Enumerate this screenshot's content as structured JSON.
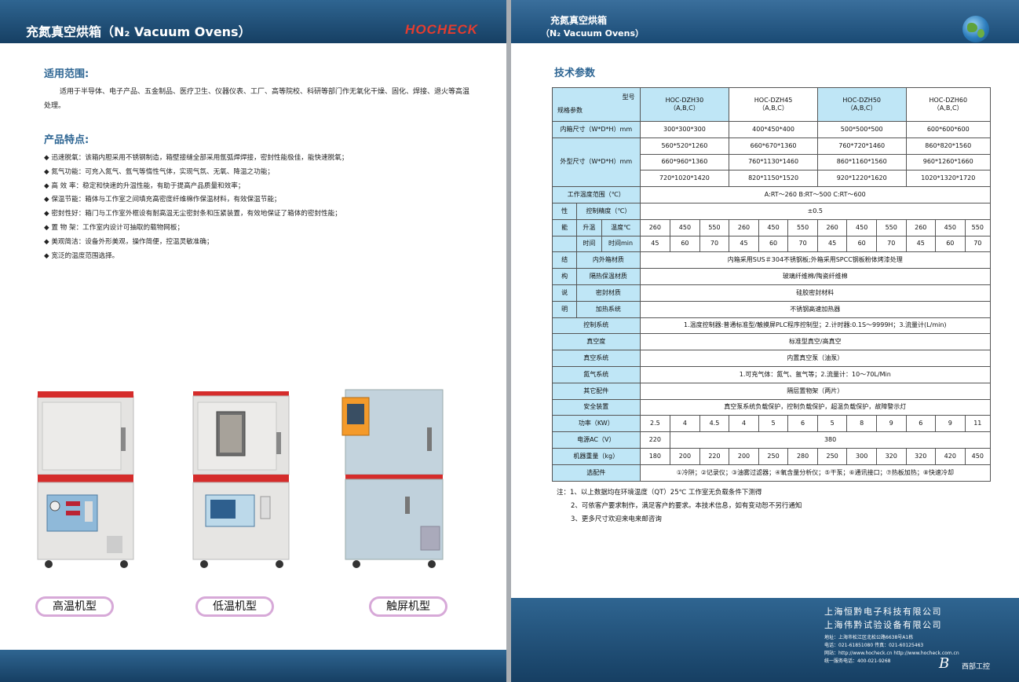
{
  "left": {
    "title": "充氮真空烘箱（N₂ Vacuum Ovens）",
    "logo": "HOCHECK",
    "scope": {
      "heading": "适用范围:",
      "text": "适用于半导体、电子产品、五金制品、医疗卫生、仪器仪表、工厂、高等院校、科研等部门作无氧化干燥、固化、焊接、退火等高温处理。"
    },
    "features": {
      "heading": "产品特点:",
      "items": [
        "◆ 迅速脱氧：该箱内胆采用不锈钢制造，箱壁接缝全部采用氩弧焊焊接，密封性能极佳，能快速脱氧；",
        "◆ 氮气功能：可充入氮气、氩气等惰性气体，实现气氛、无氧、降温之功能；",
        "◆ 高 效 率：稳定和快速的升温性能，有助于提高产品质量和效率；",
        "◆ 保温节能：箱体与工作室之间填充高密度纤维棉作保温材料，有效保温节能；",
        "◆ 密封性好：箱门与工作室外框设有耐高温无尘密封条和压紧装置，有效地保证了箱体的密封性能；",
        "◆ 置 物 架：工作室内设计可抽取的载物网板；",
        "◆ 美观简洁：设备外形美观，操作简便，控温灵敏准确；",
        "◆ 宽泛的温度范围选择。"
      ]
    },
    "models": [
      "高温机型",
      "低温机型",
      "触屏机型"
    ]
  },
  "right": {
    "title_cn": "充氮真空烘箱",
    "title_en": "（N₂ Vacuum Ovens）",
    "spec_heading": "技术参数",
    "table": {
      "corner_top": "型号",
      "corner_bottom": "规格参数",
      "models": [
        "HOC-DZH30\n（A,B,C）",
        "HOC-DZH45\n（A,B,C）",
        "HOC-DZH50\n（A,B,C）",
        "HOC-DZH60\n（A,B,C）"
      ],
      "inner_label": "内箱尺寸（W*D*H）mm",
      "inner": [
        "300*300*300",
        "400*450*400",
        "500*500*500",
        "600*600*600"
      ],
      "outer_label": "外型尺寸（W*D*H）mm",
      "outer": [
        [
          "560*520*1260",
          "660*670*1360",
          "760*720*1460",
          "860*820*1560"
        ],
        [
          "660*960*1360",
          "760*1130*1460",
          "860*1160*1560",
          "960*1260*1660"
        ],
        [
          "720*1020*1420",
          "820*1150*1520",
          "920*1220*1620",
          "1020*1320*1720"
        ]
      ],
      "temp_range_label": "工作温度范围（℃）",
      "temp_range": "A:RT～260  B:RT～500  C:RT～600",
      "perf_label": [
        "性",
        "能"
      ],
      "ctrl_label": "控制精度（℃）",
      "ctrl": "±0.5",
      "rise_label": "升温",
      "rise_temp_label": "温度℃",
      "rise_temp": [
        "260",
        "450",
        "550",
        "260",
        "450",
        "550",
        "260",
        "450",
        "550",
        "260",
        "450",
        "550"
      ],
      "rise_time_label1": "时间",
      "rise_time_label2": "时间min",
      "rise_time": [
        "45",
        "60",
        "70",
        "45",
        "60",
        "70",
        "45",
        "60",
        "70",
        "45",
        "60",
        "70"
      ],
      "struct_label": [
        "结",
        "构",
        "说",
        "明"
      ],
      "struct_rows": [
        {
          "label": "内外箱材质",
          "value": "内箱采用SUS＃304不锈钢板;外箱采用SPCC钢板粉体烤漆处理"
        },
        {
          "label": "隔热保温材质",
          "value": "玻璃纤维棉/陶瓷纤维棉"
        },
        {
          "label": "密封材质",
          "value": "硅胶密封材料"
        },
        {
          "label": "加热系统",
          "value": "不锈钢高速加热器"
        }
      ],
      "rows": [
        {
          "label": "控制系统",
          "value": "1.温度控制器:普通标准型/触摸屏PLC程序控制型；2.计时器:0.1S～9999H；3.流量计(L/min)"
        },
        {
          "label": "真空度",
          "value": "标准型真空/高真空"
        },
        {
          "label": "真空系统",
          "value": "内置真空泵（油泵）"
        },
        {
          "label": "氮气系统",
          "value": "1.可充气体：氮气、氩气等；2.流量计：10～70L/Min"
        },
        {
          "label": "其它配件",
          "value": "隔层置物架（两片）"
        },
        {
          "label": "安全装置",
          "value": "真空泵系统负载保护，控制负载保护，超温负载保护，故障警示灯"
        }
      ],
      "power_label": "功率（KW）",
      "power": [
        "2.5",
        "4",
        "4.5",
        "4",
        "5",
        "6",
        "5",
        "8",
        "9",
        "6",
        "9",
        "11"
      ],
      "supply_label": "电源AC（V）",
      "supply": [
        "220",
        "380"
      ],
      "weight_label": "机器重量（kg）",
      "weight": [
        "180",
        "200",
        "220",
        "200",
        "250",
        "280",
        "250",
        "300",
        "320",
        "320",
        "420",
        "450"
      ],
      "options_label": "选配件",
      "options": "①冷阱；②记录仪；③油雾过滤器；④氧含量分析仪；⑤干泵；⑥通讯接口；⑦热板加热；⑧快速冷却"
    },
    "notes": [
      "注：1、以上数据均在环境温度（QT）25℃ 工作室无负载条件下测得",
      "2、可依客户要求制作，满足客户的要求。本技术信息，如有变动恕不另行通知",
      "3、更多尺寸欢迎来电来邮咨询"
    ],
    "company1": "上海恒黔电子科技有限公司",
    "company2": "上海伟黔试验设备有限公司",
    "contact": [
      "地址：上海市松江区北松公路6638号A1栋",
      "电话：021-61851080                传真：021-60125463",
      "网站：http://www.hocheck.cn   http://www.hocheck.com.cn",
      "统一服务电话：400-021-9268"
    ],
    "signature": "B",
    "signature_text": "西部工控",
    "colors": {
      "header": "#1f4f78",
      "table_label": "#bfe6f6",
      "accent": "#2d6593",
      "caption_border": "#d7a9d8"
    }
  }
}
